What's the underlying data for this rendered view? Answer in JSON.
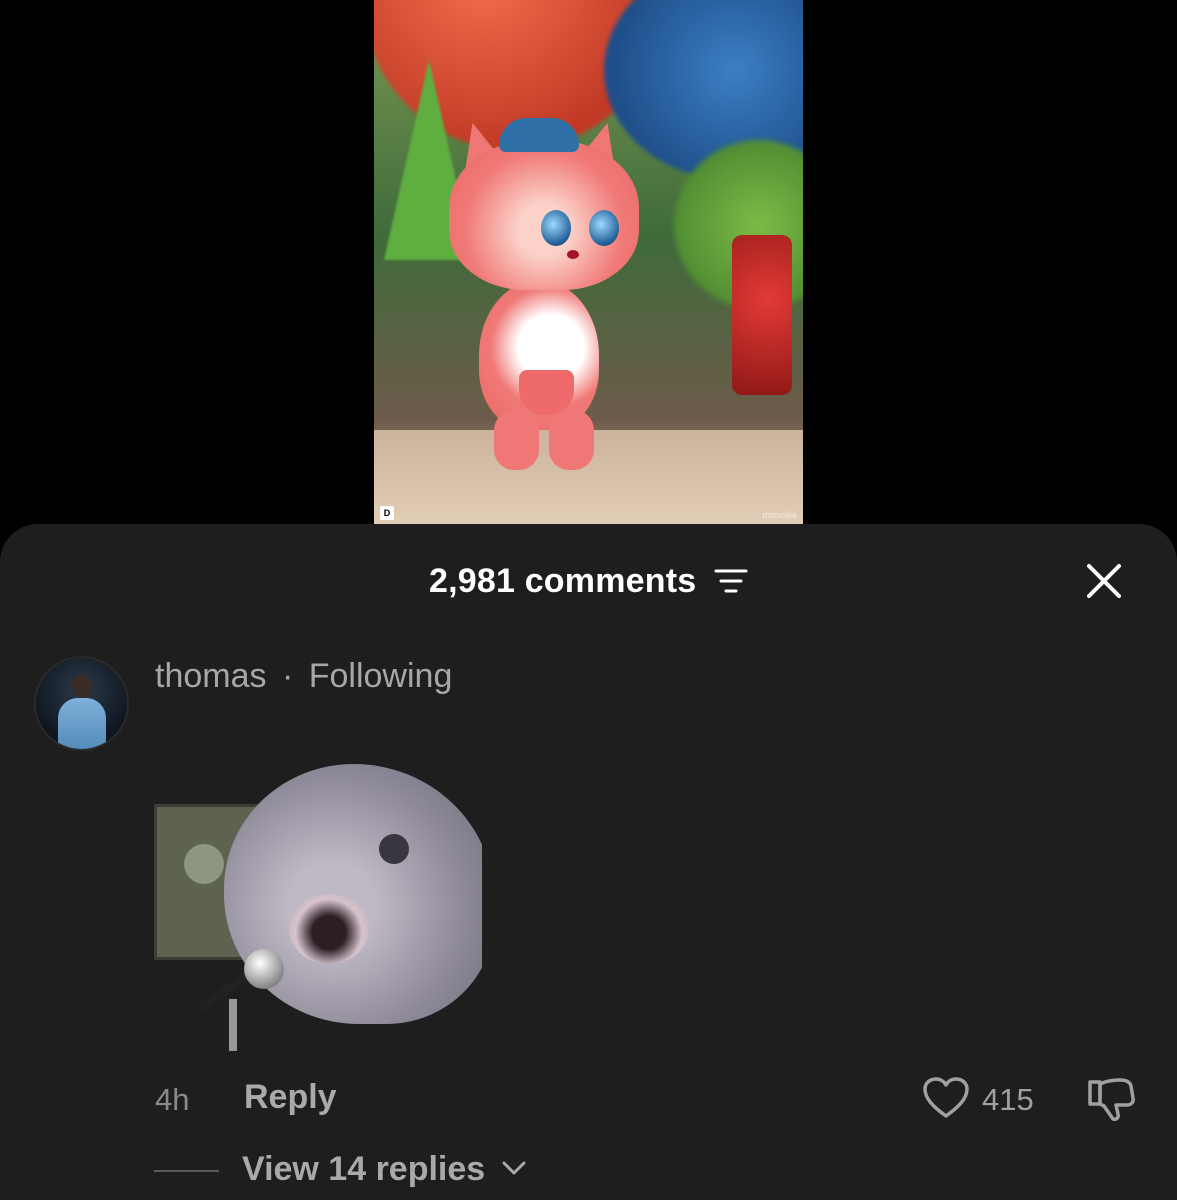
{
  "video": {
    "logo_left": "D",
    "logo_right": "monolee"
  },
  "comments_sheet": {
    "title": "2,981 comments",
    "filter_icon": "filter-icon",
    "close_icon": "close-icon"
  },
  "comment": {
    "author": "thomas",
    "separator": "·",
    "relation": "Following",
    "attachment": "sticker",
    "time": "4h",
    "reply_label": "Reply",
    "like_count": "415",
    "like_icon": "heart-outline-icon",
    "dislike_icon": "thumbs-down-icon",
    "view_replies": "View 14 replies"
  },
  "colors": {
    "sheet_bg": "#1e1e1e",
    "text_primary": "#ffffff",
    "text_secondary": "#a9a9a9"
  }
}
